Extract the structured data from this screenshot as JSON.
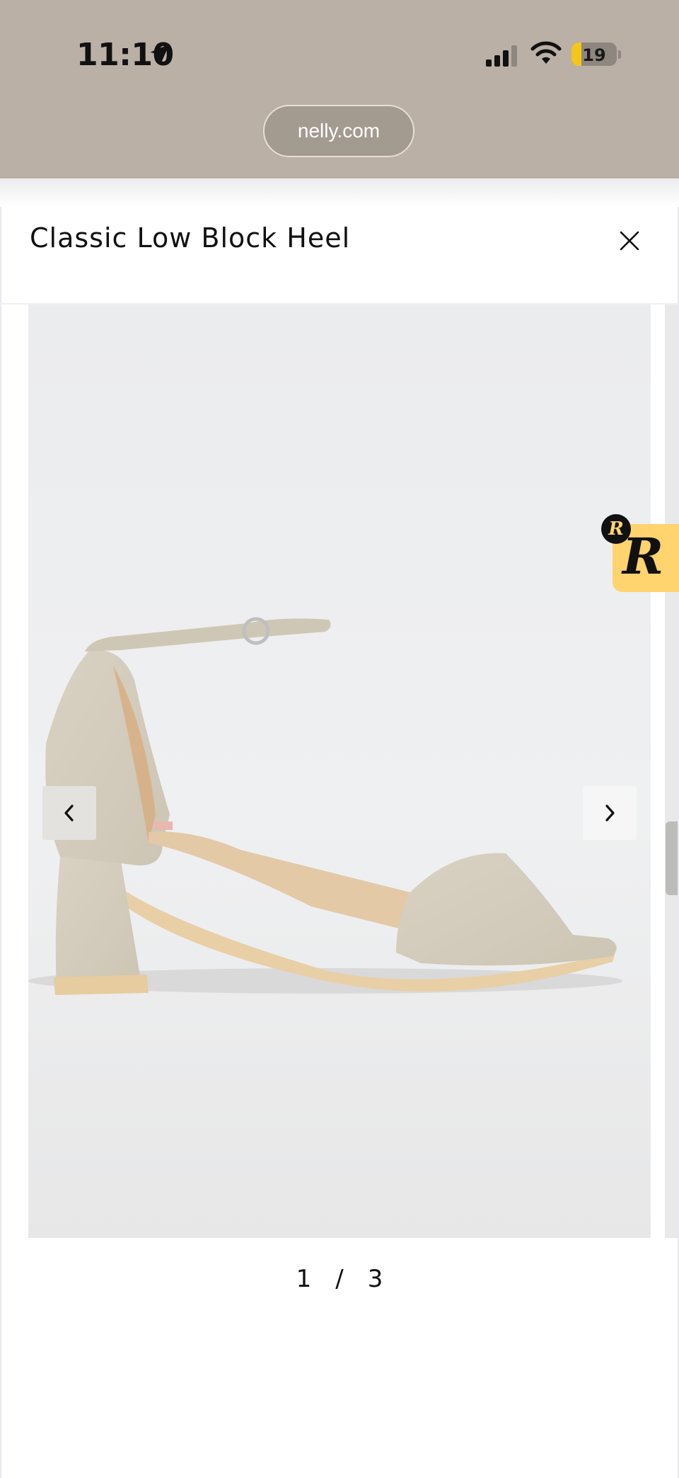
{
  "status_bar": {
    "time": "11:10",
    "battery": "19",
    "icons": [
      "location-arrow-icon",
      "cellular-signal-icon",
      "wifi-icon",
      "battery-icon"
    ]
  },
  "browser": {
    "url": "nelly.com"
  },
  "modal": {
    "title": "Classic Low Block Heel",
    "close_icon": "close-icon"
  },
  "gallery": {
    "current": "1",
    "separator": "/",
    "total": "3",
    "prev_icon": "chevron-left-icon",
    "next_icon": "chevron-right-icon"
  },
  "badge": {
    "letter": "R",
    "mini_letter": "R",
    "color": "#ffd36e"
  },
  "colors": {
    "status_bg": "#bab0a5",
    "gallery_bg": "#ebeced",
    "shoe": "#d6cfbf"
  }
}
